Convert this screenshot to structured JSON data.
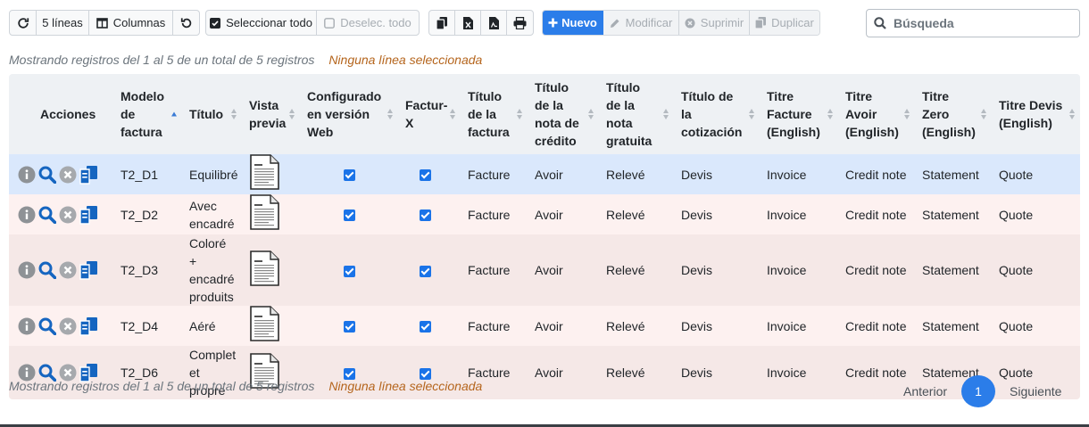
{
  "toolbar": {
    "refresh_icon": "refresh-icon",
    "lines_label": "5 líneas",
    "columns_label": "Columnas",
    "reset_icon": "undo-icon",
    "select_all_label": "Seleccionar todo",
    "deselect_all_label": "Deselec. todo",
    "new_label": "Nuevo",
    "modify_label": "Modificar",
    "delete_label": "Suprimir",
    "duplicate_label": "Duplicar"
  },
  "search": {
    "placeholder": "Búsqueda"
  },
  "info_top": {
    "showing": "Mostrando registros del 1 al 5 de un total de 5 registros",
    "selection": "Ninguna línea seleccionada"
  },
  "info_bottom": {
    "showing": "Mostrando registros del 1 al 5 de un total de 5 registros",
    "selection": "Ninguna línea seleccionada"
  },
  "table": {
    "headers": {
      "actions": "Acciones",
      "model": "Modelo de factura",
      "title": "Título",
      "preview": "Vista previa",
      "web": "Configurado en versión Web",
      "facturx": "Factur-X",
      "invoice_title": "Título de la factura",
      "credit_title": "Título de la nota de crédito",
      "free_title": "Título de la nota gratuita",
      "quote_title": "Título de la cotización",
      "invoice_en": "Titre Facture (English)",
      "credit_en": "Titre Avoir (English)",
      "zero_en": "Titre Zero (English)",
      "quote_en": "Titre Devis (English)"
    },
    "rows": [
      {
        "model": "T2_D1",
        "title": "Equilibré",
        "web": true,
        "facturx": true,
        "invoice_title": "Facture",
        "credit_title": "Avoir",
        "free_title": "Relevé",
        "quote_title": "Devis",
        "invoice_en": "Invoice",
        "credit_en": "Credit note",
        "zero_en": "Statement",
        "quote_en": "Quote"
      },
      {
        "model": "T2_D2",
        "title": "Avec encadré",
        "web": true,
        "facturx": true,
        "invoice_title": "Facture",
        "credit_title": "Avoir",
        "free_title": "Relevé",
        "quote_title": "Devis",
        "invoice_en": "Invoice",
        "credit_en": "Credit note",
        "zero_en": "Statement",
        "quote_en": "Quote"
      },
      {
        "model": "T2_D3",
        "title": "Coloré + encadré produits",
        "web": true,
        "facturx": true,
        "invoice_title": "Facture",
        "credit_title": "Avoir",
        "free_title": "Relevé",
        "quote_title": "Devis",
        "invoice_en": "Invoice",
        "credit_en": "Credit note",
        "zero_en": "Statement",
        "quote_en": "Quote"
      },
      {
        "model": "T2_D4",
        "title": "Aéré",
        "web": true,
        "facturx": true,
        "invoice_title": "Facture",
        "credit_title": "Avoir",
        "free_title": "Relevé",
        "quote_title": "Devis",
        "invoice_en": "Invoice",
        "credit_en": "Credit note",
        "zero_en": "Statement",
        "quote_en": "Quote"
      },
      {
        "model": "T2_D6",
        "title": "Complet et propre",
        "web": true,
        "facturx": true,
        "invoice_title": "Facture",
        "credit_title": "Avoir",
        "free_title": "Relevé",
        "quote_title": "Devis",
        "invoice_en": "Invoice",
        "credit_en": "Credit note",
        "zero_en": "Statement",
        "quote_en": "Quote"
      }
    ]
  },
  "pagination": {
    "previous": "Anterior",
    "current": "1",
    "next": "Siguiente"
  },
  "colors": {
    "accent": "#2b7de9",
    "selected_row": "#dae8fc",
    "row_alt_1": "#fdf1f0",
    "row_alt_2": "#f5e8e7",
    "selection_text": "#b5651d"
  }
}
